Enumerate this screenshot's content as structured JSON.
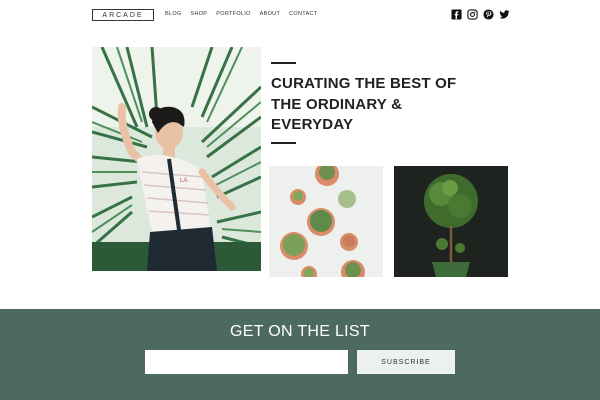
{
  "header": {
    "logo": "ARCADE",
    "nav": [
      "BLOG",
      "SHOP",
      "PORTFOLIO",
      "ABOUT",
      "CONTACT"
    ],
    "social_icons": [
      "facebook-icon",
      "instagram-icon",
      "pinterest-icon",
      "twitter-icon"
    ]
  },
  "hero": {
    "headline": "CURATING THE BEST OF THE ORDINARY & EVERYDAY"
  },
  "newsletter": {
    "title": "GET ON THE LIST",
    "email_value": "",
    "subscribe_label": "SUBSCRIBE"
  },
  "colors": {
    "footer_bg": "#4d6a5e",
    "button_bg": "#eaf1ee",
    "text": "#222222"
  }
}
